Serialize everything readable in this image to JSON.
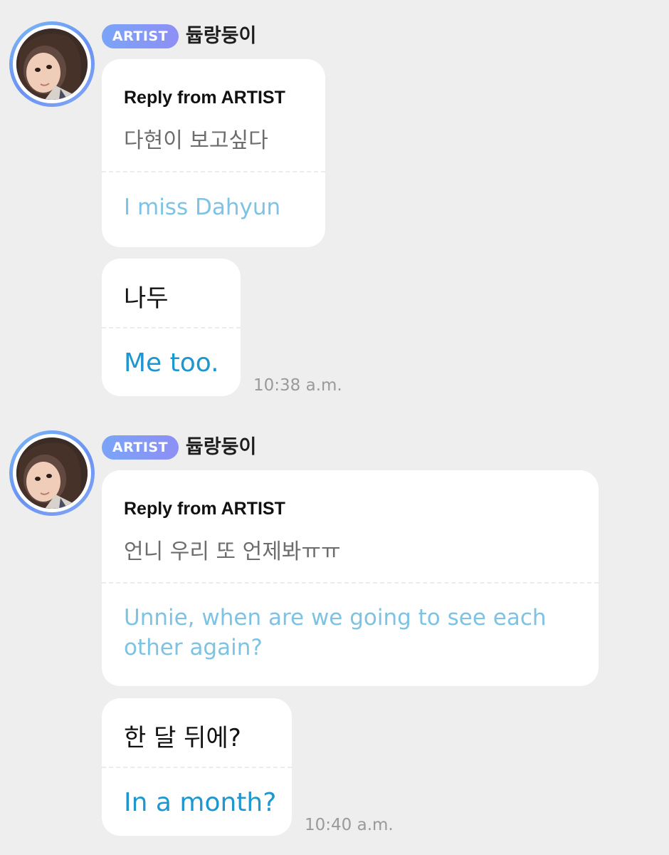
{
  "messages": [
    {
      "badge": "ARTIST",
      "sender": "듑랑둥이",
      "reply_label": "Reply from ARTIST",
      "quoted_original": "다현이 보고싶다",
      "quoted_translation": "I miss Dahyun",
      "reply_original": "나두",
      "reply_translation": "Me too.",
      "time": "10:38 a.m."
    },
    {
      "badge": "ARTIST",
      "sender": "듑랑둥이",
      "reply_label": "Reply from ARTIST",
      "quoted_original": "언니 우리 또 언제봐ㅠㅠ",
      "quoted_translation": "Unnie, when are we going to see each other again?",
      "reply_original": "한 달 뒤에?",
      "reply_translation": "In a month?",
      "time": "10:40 a.m."
    }
  ],
  "icons": {
    "avatar": "profile-photo-icon"
  },
  "colors": {
    "background": "#eeeeef",
    "badge_start": "#7aa4f7",
    "badge_end": "#8e8ff5",
    "quoted_translation": "#7ec3e3",
    "reply_translation": "#1e96cf",
    "timestamp": "#9a9a9a"
  }
}
